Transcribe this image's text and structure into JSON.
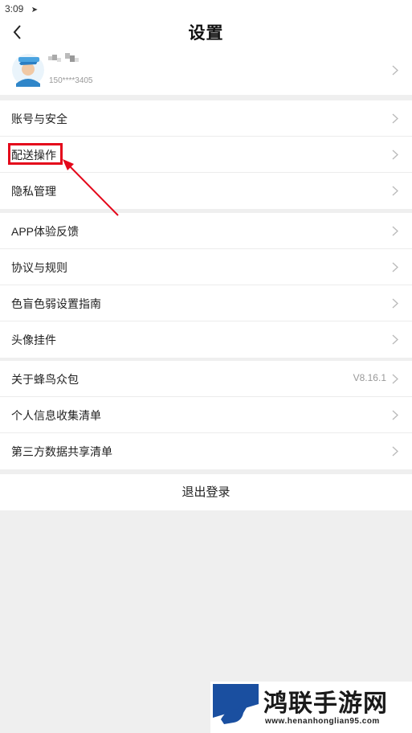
{
  "status_bar": {
    "time": "3:09",
    "nav_icon": "location-arrow-icon"
  },
  "header": {
    "title": "设置",
    "back_icon": "chevron-left-icon"
  },
  "profile": {
    "phone": "150****3405",
    "avatar_icon": "courier-avatar-icon"
  },
  "groups": [
    {
      "items": [
        {
          "label": "账号与安全"
        },
        {
          "label": "配送操作"
        },
        {
          "label": "隐私管理"
        }
      ]
    },
    {
      "items": [
        {
          "label": "APP体验反馈"
        },
        {
          "label": "协议与规则"
        },
        {
          "label": "色盲色弱设置指南"
        },
        {
          "label": "头像挂件"
        }
      ]
    },
    {
      "items": [
        {
          "label": "关于蜂鸟众包",
          "value": "V8.16.1"
        },
        {
          "label": "个人信息收集清单"
        },
        {
          "label": "第三方数据共享清单"
        }
      ]
    }
  ],
  "logout": {
    "label": "退出登录"
  },
  "annotation": {
    "color": "#e4081b"
  },
  "watermark": {
    "title": "鸿联手游网",
    "url": "www.henanhonglian95.com"
  }
}
